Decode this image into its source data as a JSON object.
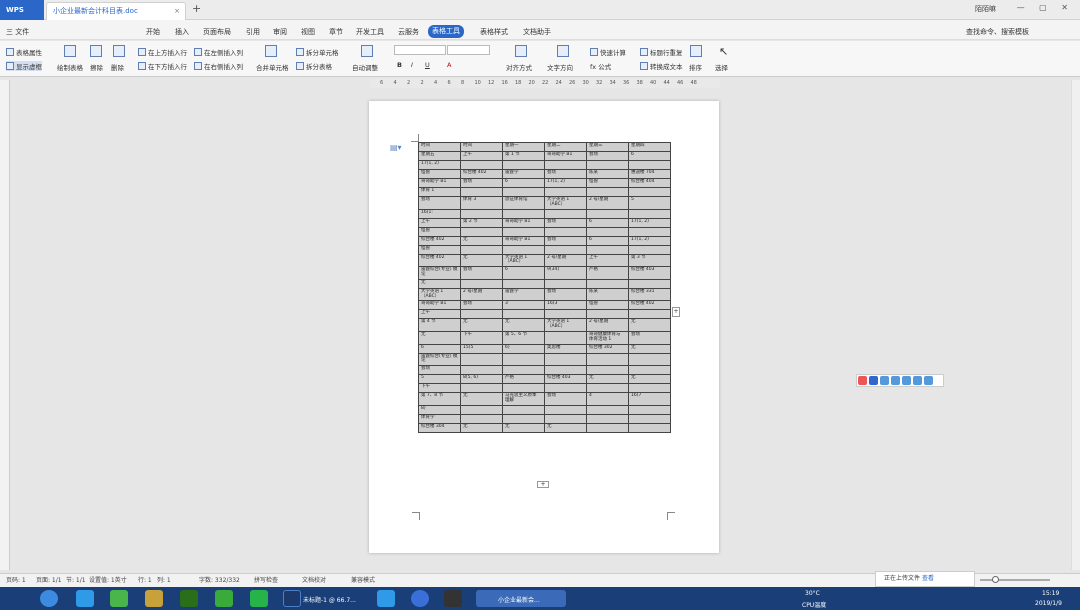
{
  "titlebar": {
    "app": "WPS",
    "doc_title": "小企业最新会计科目表.doc",
    "user": "陌陌嘛"
  },
  "menu": {
    "file": "三 文件",
    "items": [
      "开始",
      "插入",
      "页面布局",
      "引用",
      "审阅",
      "视图",
      "章节",
      "开发工具",
      "云服务",
      "表格工具",
      "表格样式",
      "文档助手"
    ],
    "active": "表格工具",
    "search": "查找命令、搜索模板"
  },
  "ribbon": {
    "table_props": "表格属性",
    "show_grid": "显示虚框",
    "draw_table": "绘制表格",
    "erase": "擦除",
    "delete": "删除",
    "insert_above": "在上方插入行",
    "insert_below": "在下方插入行",
    "insert_left": "在左侧插入列",
    "insert_right": "在右侧插入列",
    "merge": "合并单元格",
    "split_cell": "拆分单元格",
    "split_table": "拆分表格",
    "autofit": "自动调整",
    "align": "对齐方式",
    "text_dir": "文字方向",
    "quick_calc": "快速计算",
    "formula": "fx 公式",
    "header_repeat": "标题行重复",
    "to_text": "转换成文本",
    "sort": "排序",
    "select": "选择",
    "font_b": "B",
    "font_i": "I",
    "font_u": "U",
    "font_a": "A"
  },
  "ruler": [
    "6",
    "4",
    "2",
    "2",
    "4",
    "6",
    "8",
    "10",
    "12",
    "16",
    "18",
    "20",
    "22",
    "24",
    "26",
    "30",
    "32",
    "34",
    "36",
    "38",
    "40",
    "44",
    "46",
    "48"
  ],
  "table": [
    [
      "时间",
      "时间",
      "星期一",
      "星期二",
      "星期三",
      "星期四"
    ],
    [
      "星期五",
      "上午",
      "第 1 节",
      "哥哥助学 B1",
      "会场",
      "6"
    ],
    [
      "17(1, 2)",
      "",
      "",
      "",
      "",
      ""
    ],
    [
      "怪兽",
      "综合楼 402",
      "雷霆学",
      "会场",
      "陈某",
      "惠迪楼 704"
    ],
    [
      "哥哥助学 B1",
      "会场",
      "6",
      "17(1, 2)",
      "怪兽",
      "综合楼 404"
    ],
    [
      "体育 1",
      "",
      "",
      "",
      "",
      ""
    ],
    [
      "会场",
      "体育 3",
      "思征体育馆",
      "大学英语 1 （ABC）",
      "2 号/星期",
      "5"
    ],
    [
      "16(1:",
      "",
      "",
      "",
      "",
      ""
    ],
    [
      "上午",
      "第 2 节",
      "哥哥助学 B1",
      "会场",
      "6",
      "17(1, 2)"
    ],
    [
      "怪兽",
      "",
      "",
      "",
      "",
      ""
    ],
    [
      "综合楼 402",
      "无",
      "哥哥助学 B1",
      "会场",
      "6",
      "17(1, 2)"
    ],
    [
      "怪兽",
      "",
      "",
      "",
      "",
      ""
    ],
    [
      "综合楼 402",
      "无",
      "大学英语 1 （ABC）",
      "2 号/星期",
      "上午",
      "第 3 节"
    ],
    [
      "雷霆综合(专业) 模论",
      "会场",
      "6",
      "9(34)",
      "严格",
      "综合楼 403"
    ],
    [
      "无",
      "",
      "",
      "",
      "",
      ""
    ],
    [
      "大学英语 1 （ABC）",
      "2 号/星期",
      "雷霆学",
      "会场",
      "陈某",
      "综合楼 331"
    ],
    [
      "哥哥助学 B1",
      "会场",
      "3",
      "16(3",
      "怪兽",
      "综合楼 402"
    ],
    [
      "上午",
      "",
      "",
      "",
      "",
      ""
    ],
    [
      "第 4 节",
      "无",
      "无",
      "大学英语 1 （ABC）",
      "2 号/星期",
      "无"
    ],
    [
      "无",
      "下午",
      "第 5、6 节",
      "",
      "哥哥健康体育与 体育活动 1",
      "会场"
    ],
    [
      "6",
      "15(5",
      "6)",
      "奥思楼",
      "综合楼 302",
      "无"
    ],
    [
      "雷霆综合(专业) 模论",
      "",
      "",
      "",
      "",
      ""
    ],
    [
      "会场",
      "",
      "",
      "",
      "",
      ""
    ],
    [
      "5",
      "8(5, 6)",
      "严格",
      "综合楼 403",
      "无",
      "无"
    ],
    [
      "下午",
      "",
      "",
      "",
      "",
      ""
    ],
    [
      "第 7、8 节",
      "无",
      "马克思主义原本 理解",
      "会场",
      "4",
      "16(7"
    ],
    [
      "8)",
      "",
      "",
      "",
      "",
      ""
    ],
    [
      "体育学",
      "",
      "",
      "",
      "",
      ""
    ],
    [
      "综合楼 304",
      "无",
      "无",
      "无",
      "",
      ""
    ]
  ],
  "status": {
    "page": "页码: 1",
    "pages": "页面: 1/1",
    "section": "节: 1/1",
    "setting": "设置值: 1英寸",
    "row": "行: 1",
    "col": "列: 1",
    "words": "字数: 332/332",
    "spell": "拼写检查",
    "proof": "文档校对",
    "compat": "兼容模式",
    "upload": "正在上传文件",
    "view": "查看"
  },
  "taskbar": {
    "ps_label": "未标题-1 @ 66.7...",
    "wps_label": "小企业最新会...",
    "temp": "30°C",
    "cpu": "CPU温度",
    "time": "15:19",
    "date": "2019/1/9"
  }
}
